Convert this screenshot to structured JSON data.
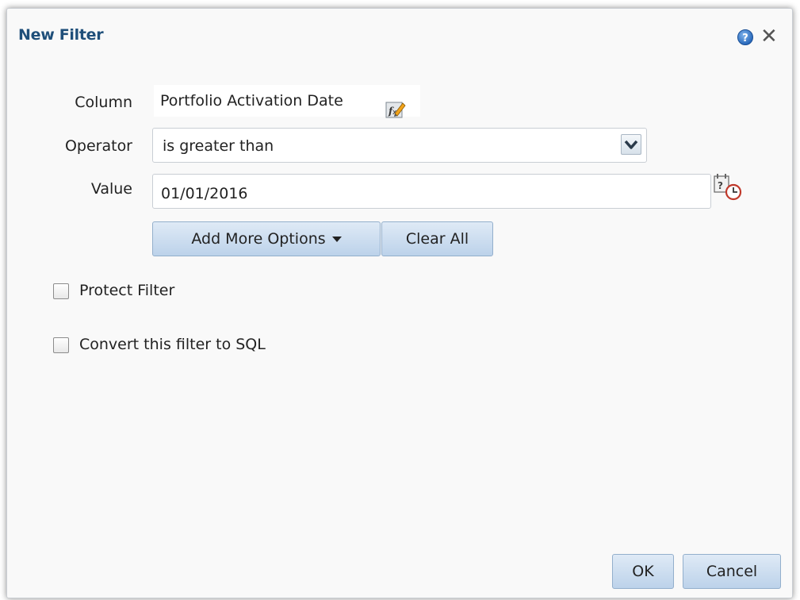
{
  "dialog": {
    "title": "New Filter",
    "help_icon": "help-icon",
    "close_icon": "close-icon",
    "close_glyph": "✕"
  },
  "form": {
    "column_label": "Column",
    "column_value": "Portfolio Activation Date",
    "column_edit_icon": "formula-edit-icon",
    "operator_label": "Operator",
    "operator_value": "is greater than",
    "value_label": "Value",
    "value_value": "01/01/2016",
    "calendar_icon": "calendar-clock-icon"
  },
  "buttons": {
    "add_more_options": "Add More Options",
    "clear_all": "Clear All",
    "ok": "OK",
    "cancel": "Cancel"
  },
  "checkboxes": {
    "protect_filter": {
      "label": "Protect Filter",
      "checked": false
    },
    "convert_sql": {
      "label": "Convert this filter to SQL",
      "checked": false
    }
  },
  "colors": {
    "title": "#1f4f7a",
    "button_top": "#dfeaf6",
    "button_bottom": "#bcd2ea",
    "dialog_bg": "#f9f9f9"
  }
}
